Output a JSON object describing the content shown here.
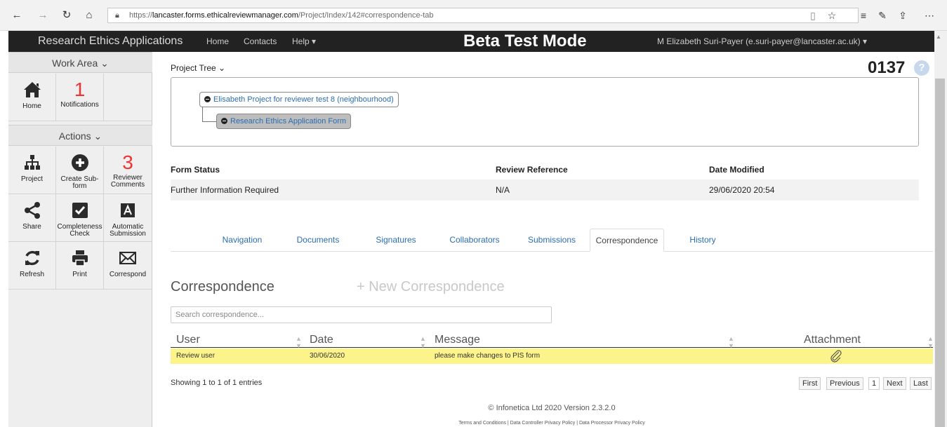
{
  "browser": {
    "url_scheme": "https://",
    "url_host": "lancaster.forms.ethicalreviewmanager.com",
    "url_path": "/Project/Index/142#correspondence-tab"
  },
  "topnav": {
    "brand": "Research Ethics Applications",
    "home": "Home",
    "contacts": "Contacts",
    "help": "Help ▾",
    "beta": "Beta Test Mode",
    "user": "M Elizabeth Suri-Payer (e.suri-payer@lancaster.ac.uk) ▾"
  },
  "sidebar": {
    "work_area": "Work Area ⌄",
    "actions": "Actions ⌄",
    "home": "Home",
    "notifications_count": "1",
    "notifications": "Notifications",
    "project": "Project",
    "create_sub_form_1": "Create Sub-",
    "create_sub_form_2": "form",
    "reviewer_comments_count": "3",
    "reviewer_comments_1": "Reviewer",
    "reviewer_comments_2": "Comments",
    "share": "Share",
    "completeness_1": "Completeness",
    "completeness_2": "Check",
    "auto_sub_1": "Automatic",
    "auto_sub_2": "Submission",
    "refresh": "Refresh",
    "print": "Print",
    "correspond": "Correspond"
  },
  "project": {
    "tree_label": "Project Tree ⌄",
    "number": "0137",
    "help": "?",
    "root_node": "Elisabeth Project for reviewer test 8 (neighbourhood)",
    "child_node": "Research Ethics Application Form"
  },
  "status": {
    "headers": [
      "Form Status",
      "Review Reference",
      "Date Modified"
    ],
    "values": [
      "Further Information Required",
      "N/A",
      "29/06/2020 20:54"
    ]
  },
  "tabs": [
    "Navigation",
    "Documents",
    "Signatures",
    "Collaborators",
    "Submissions",
    "Correspondence",
    "History"
  ],
  "correspondence": {
    "title": "Correspondence",
    "new_label": "+ New Correspondence",
    "search_placeholder": "Search correspondence...",
    "columns": [
      "User",
      "Date",
      "Message",
      "Attachment"
    ],
    "rows": [
      {
        "user": "Review user",
        "date": "30/06/2020",
        "message": "please make changes to PIS form"
      }
    ],
    "showing": "Showing 1 to 1 of 1 entries",
    "pager": [
      "First",
      "Previous",
      "1",
      "Next",
      "Last"
    ]
  },
  "footer": {
    "copyright": "© Infonetica Ltd 2020 Version 2.3.2.0",
    "links": "Terms and Conditions | Data Controller Privacy Policy | Data Processor Privacy Policy"
  }
}
